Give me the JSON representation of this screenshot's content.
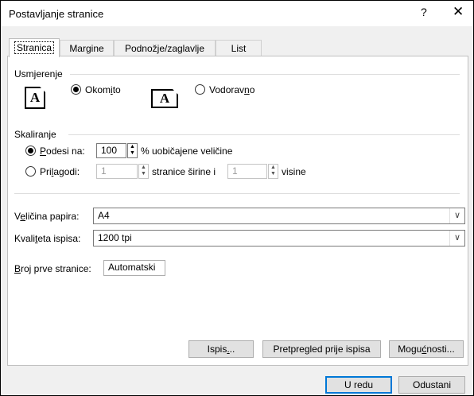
{
  "window": {
    "title": "Postavljanje stranice",
    "help_glyph": "?",
    "close_glyph": "✕"
  },
  "tabs": [
    {
      "label": "Stranica",
      "active": true
    },
    {
      "label": "Margine",
      "active": false
    },
    {
      "label": "Podnožje/zaglavlje",
      "active": false
    },
    {
      "label": "List",
      "active": false
    }
  ],
  "orientation": {
    "group_label": "Usmjerenje",
    "icon_letter": "A",
    "portrait": {
      "pre": "Okom",
      "key": "i",
      "post": "to",
      "selected": true
    },
    "landscape": {
      "pre": "Vodorav",
      "key": "n",
      "post": "o",
      "selected": false
    }
  },
  "scaling": {
    "group_label": "Skaliranje",
    "adjust": {
      "pre": "",
      "key": "P",
      "post": "odesi na:",
      "value": "100",
      "suffix": "% uobičajene veličine",
      "selected": true
    },
    "fit": {
      "pre": "Pri",
      "key": "l",
      "post": "agodi:",
      "wide_value": "1",
      "wide_suffix": "stranice širine i",
      "tall_value": "1",
      "tall_suffix": "visine",
      "selected": false
    }
  },
  "paper_size": {
    "pre": "V",
    "key": "e",
    "post": "ličina papira:",
    "value": "A4"
  },
  "print_quality": {
    "pre": "Kvali",
    "key": "t",
    "post": "eta ispisa:",
    "value": "1200 tpi"
  },
  "first_page": {
    "pre": "",
    "key": "B",
    "post": "roj prve stranice:",
    "value": "Automatski"
  },
  "buttons": {
    "print": {
      "pre": "Ispis",
      "key": ".",
      "post": ".."
    },
    "preview": {
      "pre": "Pretpre",
      "key": "g",
      "post": "led prije ispisa"
    },
    "options": {
      "pre": "Mogu",
      "key": "ć",
      "post": "nosti..."
    },
    "ok": "U redu",
    "cancel": "Odustani"
  },
  "colors": {
    "accent": "#0078d7",
    "window_bg": "#f0f0f0",
    "panel_bg": "#ffffff"
  },
  "icons": {
    "chevron": "chevron-down-icon",
    "spin": "spinner-arrows-icon",
    "close": "close-icon"
  }
}
